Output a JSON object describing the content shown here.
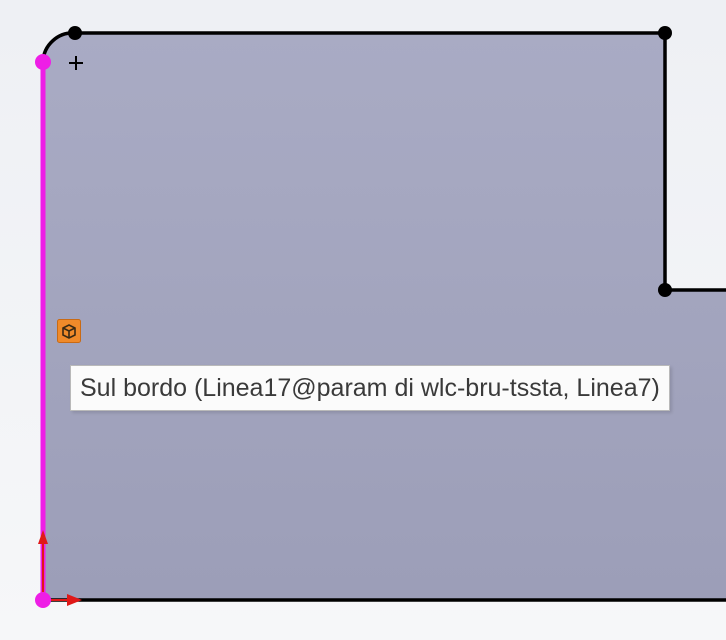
{
  "tooltip": {
    "text": "Sul bordo (Linea17@param di wlc-bru-tssta, Linea7)"
  },
  "icons": {
    "relation": "on-edge-relation-icon",
    "cursor": "plus-cursor-icon",
    "axis_x": "x-axis-arrow-icon",
    "axis_y": "y-axis-arrow-icon"
  },
  "colors": {
    "face_fill": "#a1a3bd",
    "sketch_line": "#000000",
    "selected_line": "#ee1ee6",
    "axis_arrow": "#e01818",
    "relation_icon": "#f08a2a"
  }
}
